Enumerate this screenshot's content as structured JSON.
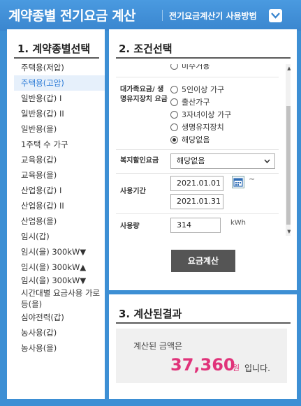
{
  "header": {
    "title": "계약종별 전기요금 계산",
    "howto_label": "전기요금계산기 사용방법",
    "accent": "#3d8fd4"
  },
  "left_panel": {
    "title": "1. 계약종별선택",
    "items": [
      {
        "label": "주택용(저압)"
      },
      {
        "label": "주택용(고압)",
        "active": true
      },
      {
        "label": "일반용(갑) I"
      },
      {
        "label": "일반용(갑) II"
      },
      {
        "label": "일반용(을)"
      },
      {
        "label": "1주택 수 가구"
      },
      {
        "label": "교육용(갑)"
      },
      {
        "label": "교육용(을)"
      },
      {
        "label": "산업용(갑) I"
      },
      {
        "label": "산업용(갑) II"
      },
      {
        "label": "산업용(을)"
      },
      {
        "label": "임시(갑)"
      },
      {
        "label": "임시(을) 300kW▼"
      },
      {
        "label": "임시(을) 300kW▲"
      },
      {
        "label": "임시(을) 300kW▼"
      },
      {
        "label": "시간대별 요금사용 가로등(을)"
      },
      {
        "label": "심야전력(갑)"
      },
      {
        "label": "농사용(갑)"
      },
      {
        "label": "농사용(을)"
      }
    ]
  },
  "conditions": {
    "title": "2. 조건선택",
    "partial_option": "미수거용",
    "discount_label": "대가족요금/ 생명유지장치 요금",
    "discount_options": [
      {
        "label": "5인이상 가구",
        "checked": false
      },
      {
        "label": "출산가구",
        "checked": false
      },
      {
        "label": "3자녀이상 가구",
        "checked": false
      },
      {
        "label": "생명유지장치",
        "checked": false
      },
      {
        "label": "해당없음",
        "checked": true
      }
    ],
    "welfare_label": "복지할인요금",
    "welfare_value": "해당없음",
    "period_label": "사용기간",
    "period_start": "2021.01.01",
    "period_tilde": "~",
    "period_end": "2021.01.31",
    "usage_label": "사용량",
    "usage_value": "314",
    "usage_unit": "kWh",
    "calc_button": "요금계산"
  },
  "result": {
    "title": "3. 계산된결과",
    "label": "계산된 금액은",
    "amount": "37,360",
    "currency": "원",
    "suffix": "입니다.",
    "amount_color": "#e0337a"
  }
}
